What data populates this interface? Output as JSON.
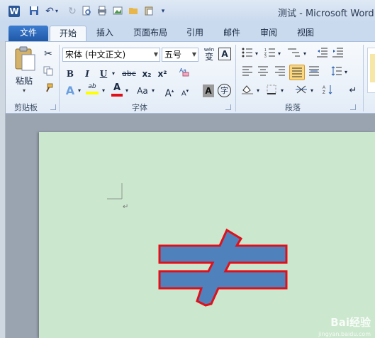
{
  "window": {
    "title": "测试 - Microsoft Word",
    "app_icon": "W"
  },
  "tabs": [
    "文件",
    "开始",
    "插入",
    "页面布局",
    "引用",
    "邮件",
    "审阅",
    "视图"
  ],
  "clipboard": {
    "paste_label": "粘贴",
    "group_label": "剪贴板"
  },
  "font": {
    "family_value": "宋体 (中文正文)",
    "size_value": "五号",
    "wen_label": "wén",
    "wen_char": "变",
    "border_char": "A",
    "bold": "B",
    "italic": "I",
    "underline": "U",
    "strike": "abc",
    "sub": "x₂",
    "sup": "x²",
    "highlight": "ab",
    "color_a": "A",
    "aa": "Aa",
    "grow": "A",
    "shrink": "A",
    "shade_a": "A",
    "enclose": "字",
    "group_label": "字体"
  },
  "paragraph": {
    "group_label": "段落"
  },
  "colors": {
    "shape_fill": "#4f81bd",
    "shape_stroke": "#e0101a",
    "page_bg": "#cbe7cd",
    "highlight_yellow": "#ffff00",
    "font_red": "#e0101a"
  },
  "watermark": {
    "text": "Bai经验",
    "sub": "jingyan.baidu.com"
  }
}
